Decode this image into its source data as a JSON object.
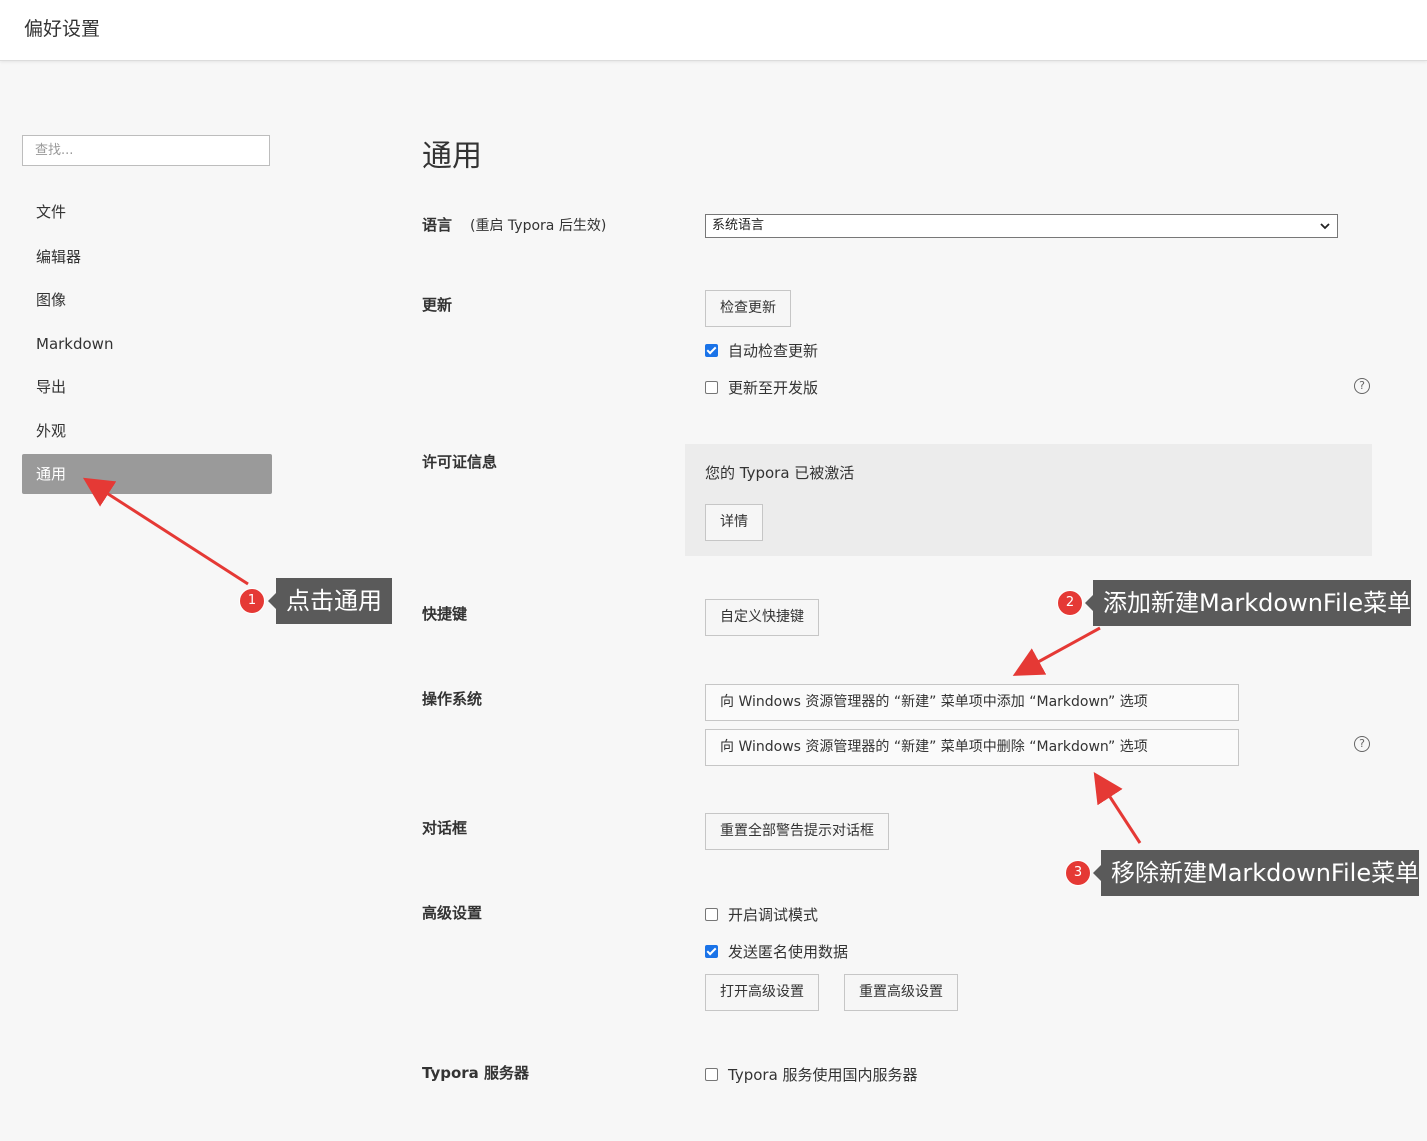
{
  "window": {
    "title": "偏好设置"
  },
  "sidebar": {
    "search_placeholder": "查找...",
    "items": [
      {
        "label": "文件"
      },
      {
        "label": "编辑器"
      },
      {
        "label": "图像"
      },
      {
        "label": "Markdown"
      },
      {
        "label": "导出"
      },
      {
        "label": "外观"
      },
      {
        "label": "通用",
        "active": true
      }
    ]
  },
  "main": {
    "title": "通用",
    "language": {
      "label": "语言",
      "note": "(重启 Typora 后生效)",
      "selected": "系统语言"
    },
    "update": {
      "label": "更新",
      "check_button": "检查更新",
      "auto_check": {
        "label": "自动检查更新",
        "checked": true
      },
      "dev_channel": {
        "label": "更新至开发版",
        "checked": false
      }
    },
    "license": {
      "label": "许可证信息",
      "status": "您的 Typora 已被激活",
      "details_button": "详情"
    },
    "shortcuts": {
      "label": "快捷键",
      "button": "自定义快捷键"
    },
    "os": {
      "label": "操作系统",
      "add_button": "向 Windows 资源管理器的 “新建” 菜单项中添加 “Markdown” 选项",
      "remove_button": "向 Windows 资源管理器的 “新建” 菜单项中删除 “Markdown” 选项"
    },
    "dialog": {
      "label": "对话框",
      "button": "重置全部警告提示对话框"
    },
    "advanced": {
      "label": "高级设置",
      "debug_mode": {
        "label": "开启调试模式",
        "checked": false
      },
      "send_usage": {
        "label": "发送匿名使用数据",
        "checked": true
      },
      "open_button": "打开高级设置",
      "reset_button": "重置高级设置"
    },
    "server": {
      "label": "Typora 服务器",
      "domestic": {
        "label": "Typora 服务使用国内服务器",
        "checked": false
      }
    },
    "help_glyph": "?"
  },
  "annotations": [
    {
      "number": "1",
      "text": "点击通用"
    },
    {
      "number": "2",
      "text": "添加新建MarkdownFile菜单"
    },
    {
      "number": "3",
      "text": "移除新建MarkdownFile菜单"
    }
  ],
  "colors": {
    "annotation_arrow": "#e53935",
    "callout_bg": "#5a5a5a",
    "active_nav": "#9a9a9a",
    "checkbox_on": "#1a73e8"
  }
}
